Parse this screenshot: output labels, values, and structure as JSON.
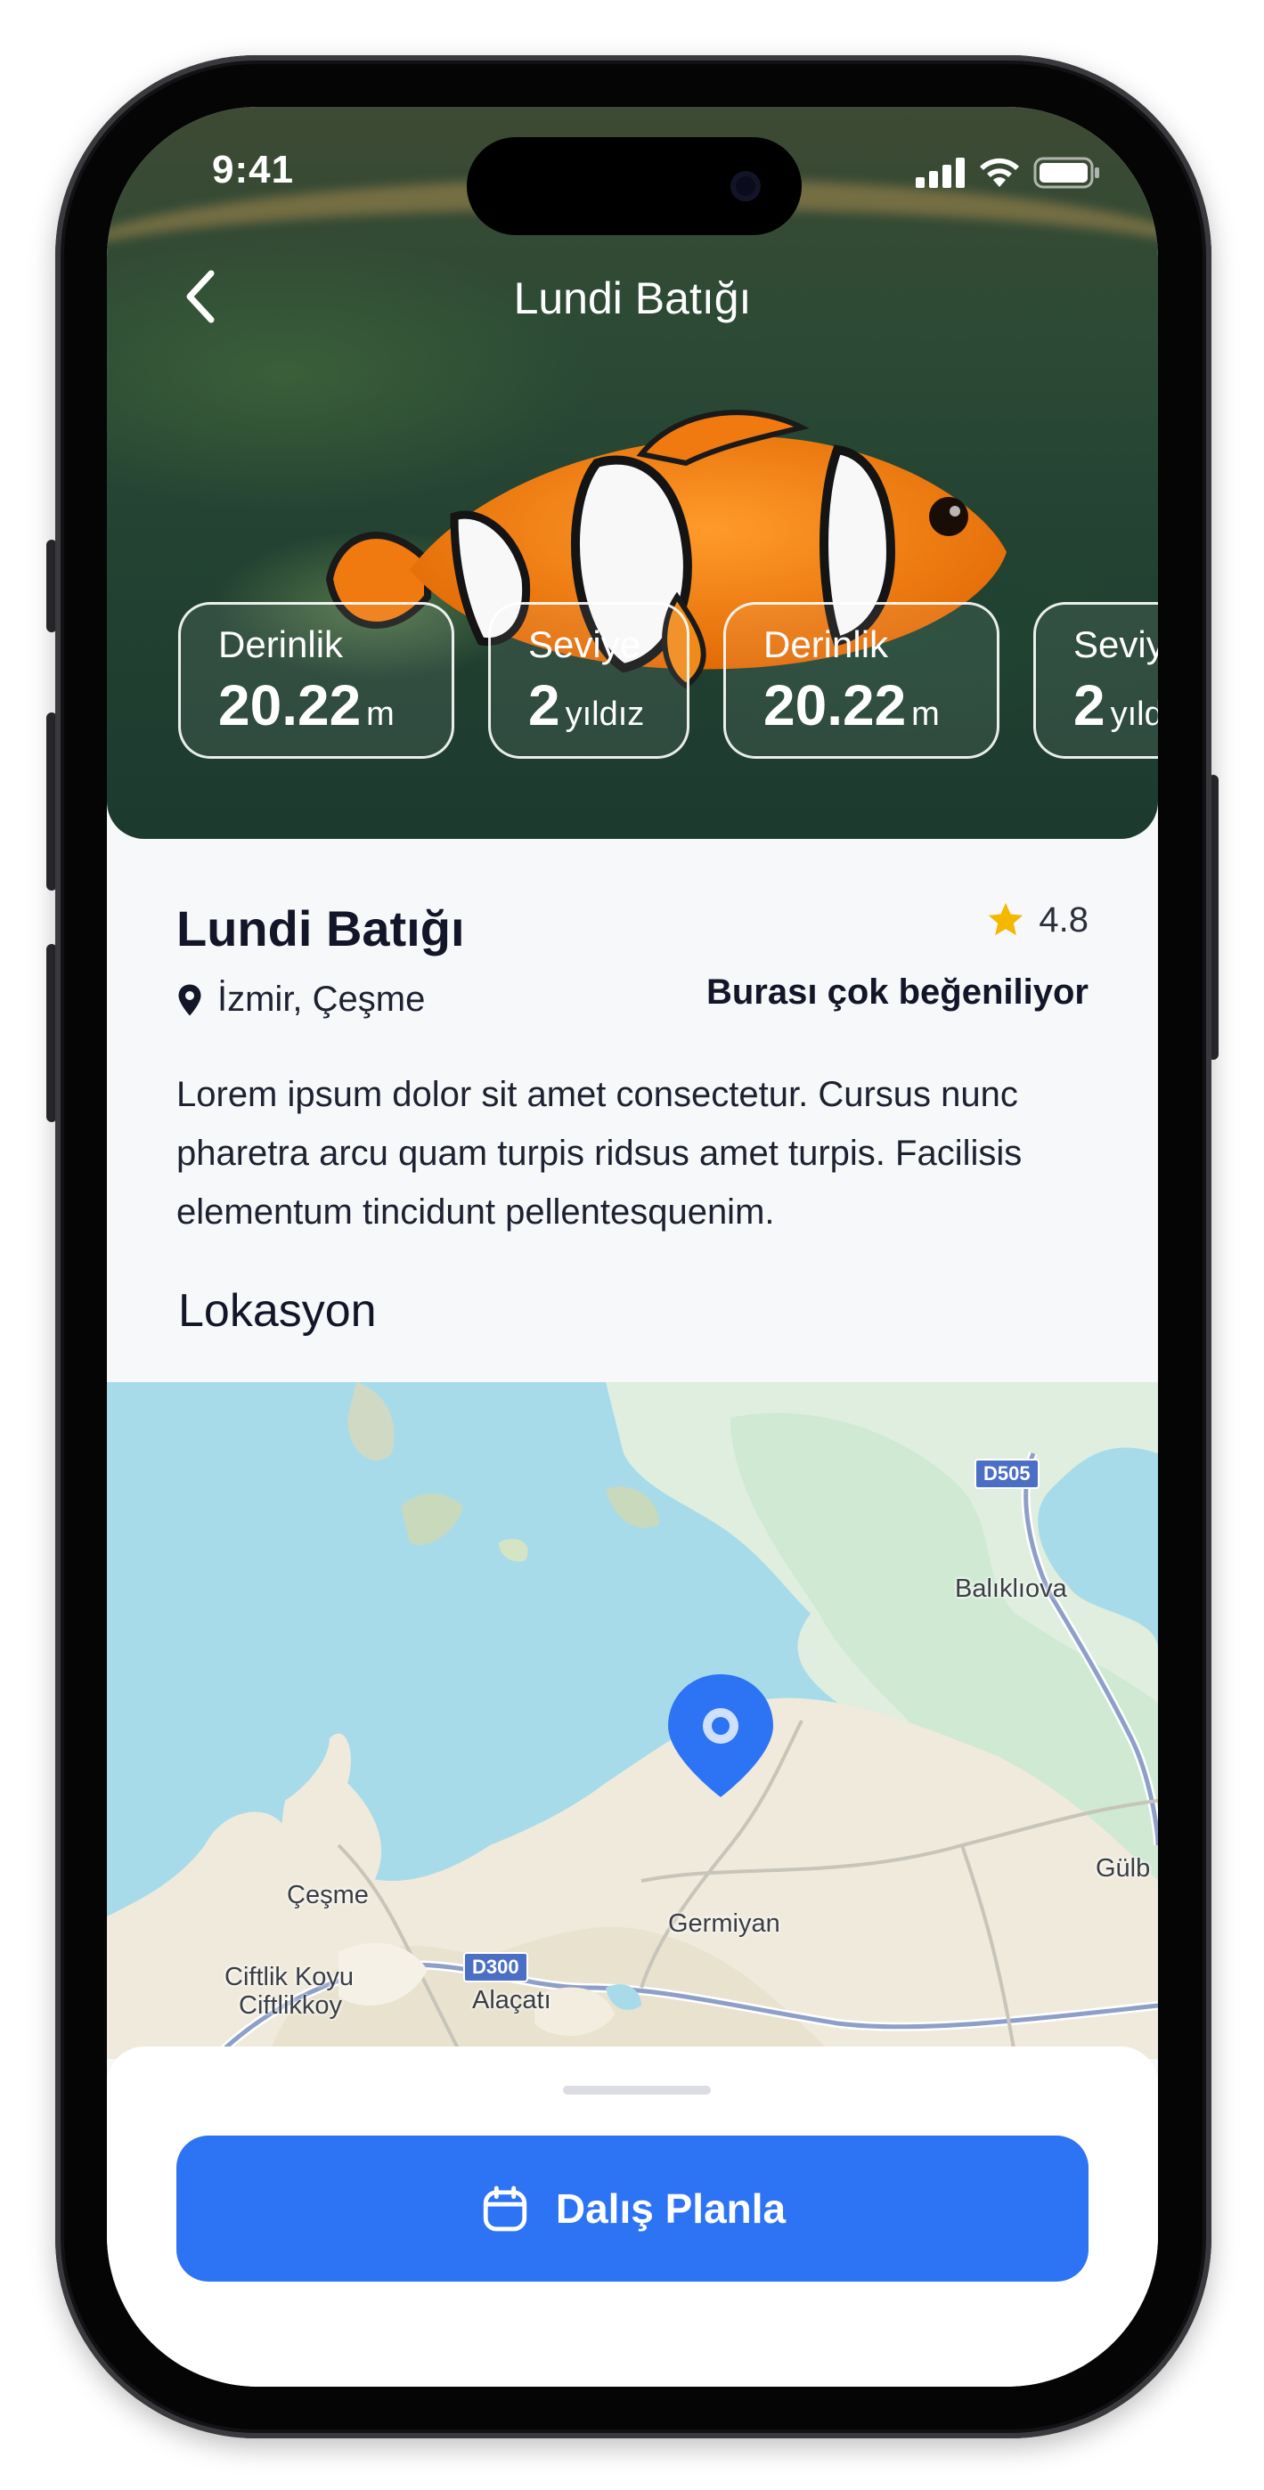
{
  "status_bar": {
    "time": "9:41"
  },
  "header": {
    "title": "Lundi Batığı",
    "back_icon": "chevron-left-icon"
  },
  "stats": [
    {
      "label": "Derinlik",
      "value": "20.22",
      "unit": "m"
    },
    {
      "label": "Seviye",
      "value": "2",
      "unit": "yıldız"
    },
    {
      "label": "Derinlik",
      "value": "20.22",
      "unit": "m"
    },
    {
      "label": "Seviye",
      "value": "2",
      "unit": "yıldız"
    }
  ],
  "place": {
    "title": "Lundi Batığı",
    "rating": "4.8",
    "location": "İzmir, Çeşme",
    "popular_text": "Burası çok beğeniliyor",
    "description": "Lorem ipsum dolor sit amet consectetur. Cursus nunc pharetra arcu quam turpis ridsus amet turpis. Facilisis elementum tincidunt pellentesquenim."
  },
  "location_section": {
    "title": "Lokasyon"
  },
  "map": {
    "labels": {
      "balikliova": "Balıklıova",
      "germiyan": "Germiyan",
      "cesme": "Çeşme",
      "ciftlik_koyu": "Ciftlik Koyu",
      "ciftlikkoy": "Ciftlikkoy",
      "alacati": "Alaçatı",
      "gulb": "Gülb"
    },
    "road_badges": {
      "d505": "D505",
      "d300": "D300"
    }
  },
  "cta": {
    "label": "Dalış Planla",
    "icon": "calendar-icon"
  },
  "colors": {
    "accent": "#2D74F5",
    "star": "#F5B800",
    "text_dark": "#121628"
  }
}
